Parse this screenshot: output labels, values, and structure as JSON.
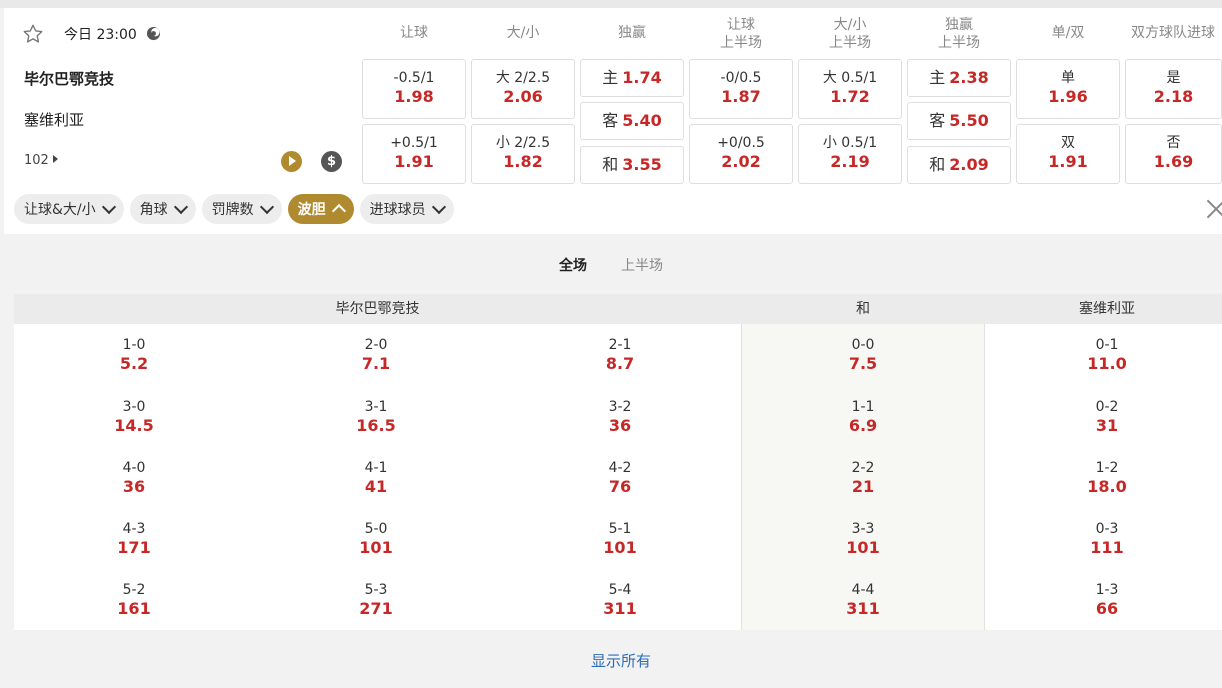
{
  "match": {
    "time": "今日 23:00",
    "home": "毕尔巴鄂竞技",
    "away": "塞维利亚",
    "more_count": "102"
  },
  "market_headers": [
    [
      "让球",
      ""
    ],
    [
      "大/小",
      ""
    ],
    [
      "独赢",
      ""
    ],
    [
      "让球",
      "上半场"
    ],
    [
      "大/小",
      "上半场"
    ],
    [
      "独赢",
      "上半场"
    ],
    [
      "单/双",
      ""
    ],
    [
      "双方球队进球",
      ""
    ]
  ],
  "markets": {
    "hdp_ft": [
      {
        "line": "-0.5/1",
        "odds": "1.98"
      },
      {
        "line": "+0.5/1",
        "odds": "1.91"
      }
    ],
    "ou_ft": [
      {
        "line": "大 2/2.5",
        "odds": "2.06"
      },
      {
        "line": "小 2/2.5",
        "odds": "1.82"
      }
    ],
    "x12_ft": [
      {
        "label": "主",
        "odds": "1.74"
      },
      {
        "label": "客",
        "odds": "5.40"
      },
      {
        "label": "和",
        "odds": "3.55"
      }
    ],
    "hdp_1h": [
      {
        "line": "-0/0.5",
        "odds": "1.87"
      },
      {
        "line": "+0/0.5",
        "odds": "2.02"
      }
    ],
    "ou_1h": [
      {
        "line": "大 0.5/1",
        "odds": "1.72"
      },
      {
        "line": "小 0.5/1",
        "odds": "2.19"
      }
    ],
    "x12_1h": [
      {
        "label": "主",
        "odds": "2.38"
      },
      {
        "label": "客",
        "odds": "5.50"
      },
      {
        "label": "和",
        "odds": "2.09"
      }
    ],
    "oe": [
      {
        "label": "单",
        "odds": "1.96"
      },
      {
        "label": "双",
        "odds": "1.91"
      }
    ],
    "btts": [
      {
        "label": "是",
        "odds": "2.18"
      },
      {
        "label": "否",
        "odds": "1.69"
      }
    ]
  },
  "bet_tabs": [
    {
      "label": "让球&大/小",
      "active": false
    },
    {
      "label": "角球",
      "active": false
    },
    {
      "label": "罚牌数",
      "active": false
    },
    {
      "label": "波胆",
      "active": true
    },
    {
      "label": "进球球员",
      "active": false
    }
  ],
  "period_tabs": [
    {
      "label": "全场",
      "active": true
    },
    {
      "label": "上半场",
      "active": false
    }
  ],
  "correct_score": {
    "headers": {
      "home": "毕尔巴鄂竞技",
      "draw": "和",
      "away": "塞维利亚"
    },
    "rows": [
      {
        "home": [
          [
            "1-0",
            "5.2"
          ],
          [
            "2-0",
            "7.1"
          ],
          [
            "2-1",
            "8.7"
          ]
        ],
        "draw": [
          "0-0",
          "7.5"
        ],
        "away": [
          "0-1",
          "11.0"
        ]
      },
      {
        "home": [
          [
            "3-0",
            "14.5"
          ],
          [
            "3-1",
            "16.5"
          ],
          [
            "3-2",
            "36"
          ]
        ],
        "draw": [
          "1-1",
          "6.9"
        ],
        "away": [
          "0-2",
          "31"
        ]
      },
      {
        "home": [
          [
            "4-0",
            "36"
          ],
          [
            "4-1",
            "41"
          ],
          [
            "4-2",
            "76"
          ]
        ],
        "draw": [
          "2-2",
          "21"
        ],
        "away": [
          "1-2",
          "18.0"
        ]
      },
      {
        "home": [
          [
            "4-3",
            "171"
          ],
          [
            "5-0",
            "101"
          ],
          [
            "5-1",
            "101"
          ]
        ],
        "draw": [
          "3-3",
          "101"
        ],
        "away": [
          "0-3",
          "111"
        ]
      },
      {
        "home": [
          [
            "5-2",
            "161"
          ],
          [
            "5-3",
            "271"
          ],
          [
            "5-4",
            "311"
          ]
        ],
        "draw": [
          "4-4",
          "311"
        ],
        "away": [
          "1-3",
          "66"
        ]
      }
    ]
  },
  "show_all": "显示所有",
  "colors": {
    "accent": "#b08a2e",
    "odds": "#c62828",
    "link": "#2b6db5"
  },
  "icons": {
    "favorite": "star-icon",
    "clock": "moon-clock-icon",
    "live": "play-icon",
    "cashout": "dollar-icon",
    "close": "close-icon"
  }
}
